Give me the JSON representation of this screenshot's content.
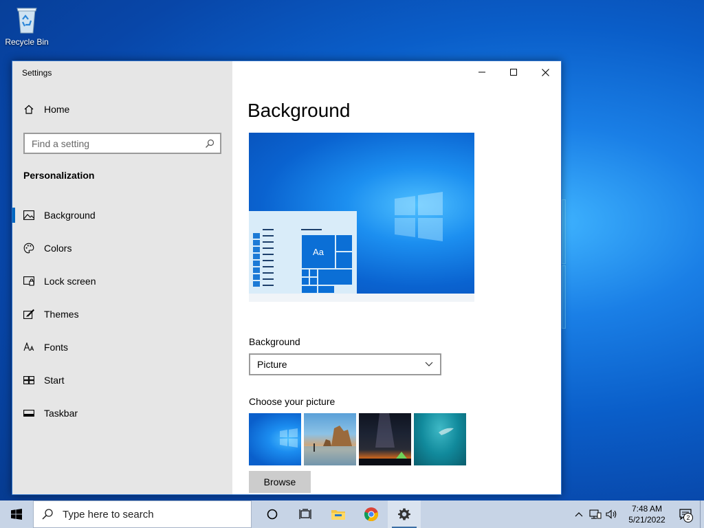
{
  "desktop": {
    "recycle_bin_label": "Recycle Bin"
  },
  "window": {
    "title": "Settings",
    "controls": [
      "minimize-icon",
      "maximize-icon",
      "close-icon"
    ]
  },
  "sidebar": {
    "home_label": "Home",
    "search_placeholder": "Find a setting",
    "section_title": "Personalization",
    "active_item": "Background",
    "items": [
      {
        "label": "Background",
        "icon": "picture-icon"
      },
      {
        "label": "Colors",
        "icon": "palette-icon"
      },
      {
        "label": "Lock screen",
        "icon": "lock-screen-icon"
      },
      {
        "label": "Themes",
        "icon": "brush-icon"
      },
      {
        "label": "Fonts",
        "icon": "fonts-icon"
      },
      {
        "label": "Start",
        "icon": "start-layout-icon"
      },
      {
        "label": "Taskbar",
        "icon": "taskbar-icon"
      }
    ]
  },
  "main": {
    "page_title": "Background",
    "preview_tile_label": "Aa",
    "background_label": "Background",
    "background_value": "Picture",
    "choose_picture_label": "Choose your picture",
    "thumbnails": [
      "windows-default",
      "beach-rocks",
      "night-sky",
      "underwater-swimmer"
    ],
    "browse_label": "Browse"
  },
  "taskbar": {
    "search_placeholder": "Type here to search",
    "apps": [
      "cortana-icon",
      "task-view-icon",
      "file-explorer-icon",
      "chrome-icon",
      "settings-icon"
    ],
    "active_app": "settings-icon",
    "time": "7:48 AM",
    "date": "5/21/2022",
    "notification_count": "2"
  },
  "colors": {
    "accent": "#0067c0",
    "sidebar_bg": "#e6e6e6",
    "taskbar_bg": "#c7d4e6"
  }
}
